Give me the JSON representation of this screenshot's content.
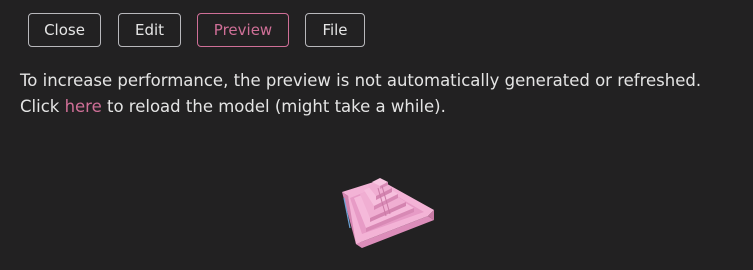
{
  "toolbar": {
    "close_label": "Close",
    "edit_label": "Edit",
    "preview_label": "Preview",
    "file_label": "File",
    "active_tab": "Preview"
  },
  "notice": {
    "line1": "To increase performance, the preview is not automatically generated or refreshed.",
    "line2_prefix": "Click ",
    "link_text": "here",
    "line2_suffix": " to reload the model (might take a while)."
  },
  "colors": {
    "background": "#222122",
    "accent": "#cf6f97",
    "model": "#e79bc6"
  },
  "preview": {
    "model_icon": "stepped-pyramid-model"
  }
}
